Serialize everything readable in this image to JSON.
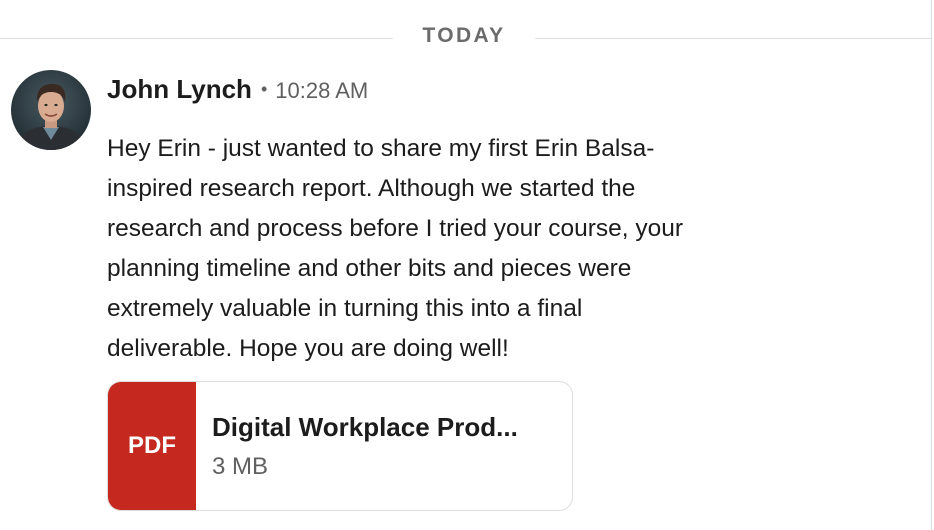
{
  "divider": {
    "label": "TODAY"
  },
  "message": {
    "author": "John Lynch",
    "separator": "•",
    "time": "10:28 AM",
    "avatar_icon": "user-avatar-photo",
    "body_lines": [
      "Hey Erin - just wanted to share my first Erin Balsa-",
      "inspired research report. Although we started the",
      "research and process before I tried your course, your",
      "planning timeline and other bits and pieces were",
      "extremely valuable in turning this into a final",
      "deliverable. Hope you are doing well!"
    ]
  },
  "attachment": {
    "type_label": "PDF",
    "file_name": "Digital Workplace Prod...",
    "file_size": "3 MB",
    "icon": "pdf-file-icon",
    "type_color": "#c4281f"
  }
}
